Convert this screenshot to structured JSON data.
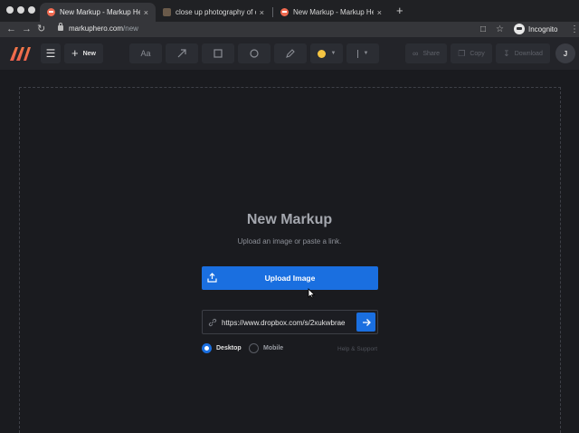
{
  "browser": {
    "tabs": [
      {
        "title": "New Markup - Markup Hero",
        "favicon": "markuphero-favicon",
        "active": true
      },
      {
        "title": "close up photography of cupcake",
        "favicon": "photo-favicon",
        "active": false
      },
      {
        "title": "New Markup - Markup Hero",
        "favicon": "markuphero-favicon",
        "active": false
      }
    ],
    "tab_close_glyph": "×",
    "new_tab_glyph": "+",
    "address": {
      "host": "markuphero.com",
      "path": "/new"
    },
    "profile_label": "Incognito"
  },
  "toolbar": {
    "new_label": "New",
    "text_tool_label": "Aa",
    "share_label": "Share",
    "copy_label": "Copy",
    "download_label": "Download",
    "avatar_initial": "J",
    "color_value": "#f5c542"
  },
  "main": {
    "title": "New Markup",
    "subtitle": "Upload an image or paste a link.",
    "upload_label": "Upload Image",
    "link_value": "https://www.dropbox.com/s/2xukwbrae",
    "options": [
      {
        "label": "Desktop",
        "selected": true
      },
      {
        "label": "Mobile",
        "selected": false
      }
    ],
    "help_label": "Help & Support"
  },
  "colors": {
    "accent": "#1a6fe0",
    "background": "#1a1b1f",
    "toolbar": "#232429"
  }
}
